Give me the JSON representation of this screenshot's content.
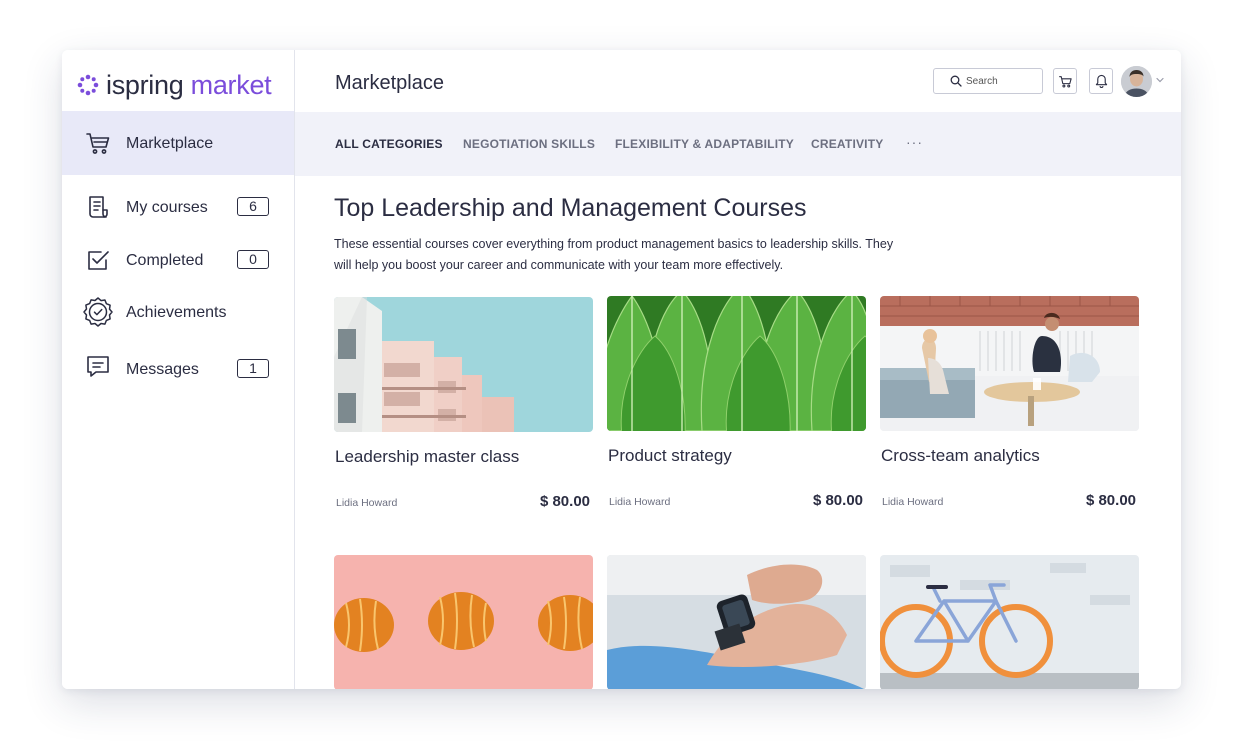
{
  "brand": {
    "name_part1": "ispring",
    "name_part2": "market",
    "accent": "#7b4ddb"
  },
  "sidebar": {
    "items": [
      {
        "label": "Marketplace",
        "icon": "cart-icon",
        "active": true
      },
      {
        "label": "My courses",
        "icon": "document-icon",
        "count": "6"
      },
      {
        "label": "Completed",
        "icon": "checkbox-icon",
        "count": "0"
      },
      {
        "label": "Achievements",
        "icon": "badge-icon"
      },
      {
        "label": "Messages",
        "icon": "chat-icon",
        "count": "1"
      }
    ]
  },
  "header": {
    "title": "Marketplace",
    "search_placeholder": "Search",
    "icons": [
      "search-icon",
      "cart-icon",
      "bell-icon",
      "avatar",
      "chevron-down-icon"
    ]
  },
  "categories": {
    "items": [
      "ALL CATEGORIES",
      "NEGOTIATION SKILLS",
      "FLEXIBILITY & ADAPTABILITY",
      "CREATIVITY"
    ],
    "more": "···"
  },
  "section": {
    "title": "Top Leadership and Management Courses",
    "description": "These essential courses cover everything from product management basics to leadership skills. They will help you boost your career and communicate with your team more effectively."
  },
  "courses": [
    {
      "title": "Leadership master class",
      "author": "Lidia Howard",
      "price": "$ 80.00",
      "image": "building-photo"
    },
    {
      "title": "Product strategy",
      "author": "Lidia Howard",
      "price": "$ 80.00",
      "image": "leaves-photo"
    },
    {
      "title": "Cross-team analytics",
      "author": "Lidia Howard",
      "price": "$ 80.00",
      "image": "office-meeting-photo"
    },
    {
      "image": "oranges-photo"
    },
    {
      "image": "smartwatch-photo"
    },
    {
      "image": "bicycle-photo"
    }
  ]
}
